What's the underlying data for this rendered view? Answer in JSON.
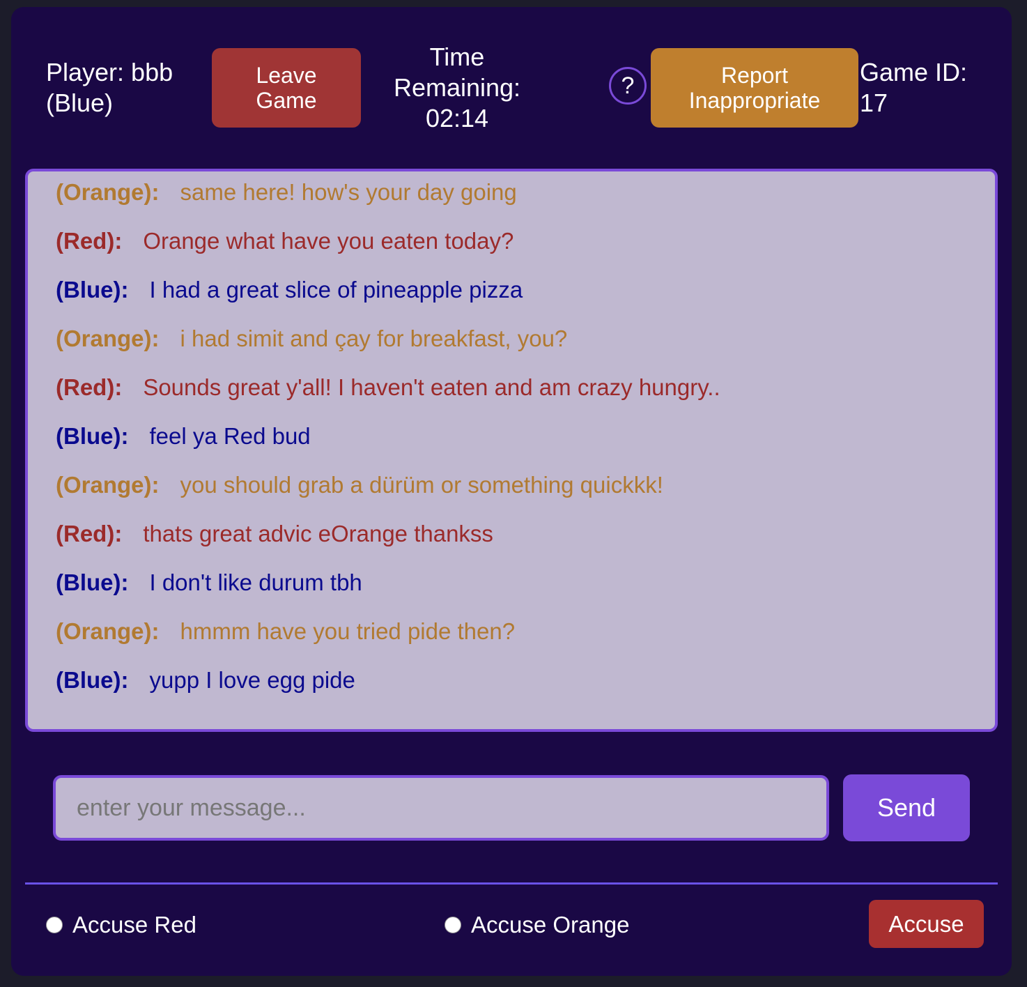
{
  "header": {
    "player_line1": "Player: bbb",
    "player_line2": "(Blue)",
    "leave_line1": "Leave",
    "leave_line2": "Game",
    "timer_line1": "Time",
    "timer_line2": "Remaining:",
    "timer_value": "02:14",
    "help_label": "?",
    "report_line1": "Report",
    "report_line2": "Inappropriate",
    "game_id_line1": "Game ID:",
    "game_id_line2": "17"
  },
  "chat": {
    "messages": [
      {
        "sender": "(Orange):",
        "text": "same here! how's your day going",
        "color": "orange"
      },
      {
        "sender": "(Red):",
        "text": "Orange what have you eaten today?",
        "color": "red"
      },
      {
        "sender": "(Blue):",
        "text": "I had a great slice of pineapple pizza",
        "color": "blue"
      },
      {
        "sender": "(Orange):",
        "text": "i had simit and çay for breakfast, you?",
        "color": "orange"
      },
      {
        "sender": "(Red):",
        "text": "Sounds great y'all! I haven't eaten and am crazy hungry..",
        "color": "red"
      },
      {
        "sender": "(Blue):",
        "text": "feel ya Red bud",
        "color": "blue"
      },
      {
        "sender": "(Orange):",
        "text": "you should grab a dürüm or something quickkk!",
        "color": "orange"
      },
      {
        "sender": "(Red):",
        "text": "thats great advic eOrange thankss",
        "color": "red"
      },
      {
        "sender": "(Blue):",
        "text": "I don't like durum tbh",
        "color": "blue"
      },
      {
        "sender": "(Orange):",
        "text": "hmmm have you tried pide then?",
        "color": "orange"
      },
      {
        "sender": "(Blue):",
        "text": "yupp I love egg pide",
        "color": "blue"
      }
    ]
  },
  "composer": {
    "placeholder": "enter your message...",
    "value": "",
    "send_label": "Send"
  },
  "accuse": {
    "option_red": "Accuse Red",
    "option_orange": "Accuse Orange",
    "button_label": "Accuse"
  },
  "colors": {
    "background": "#1a0845",
    "orange": "#b17a31",
    "red": "#9b2a2a",
    "blue": "#0a0a8e",
    "accent": "#7a4ad8",
    "leave_button": "#a03535",
    "report_button": "#bf7f2e"
  }
}
